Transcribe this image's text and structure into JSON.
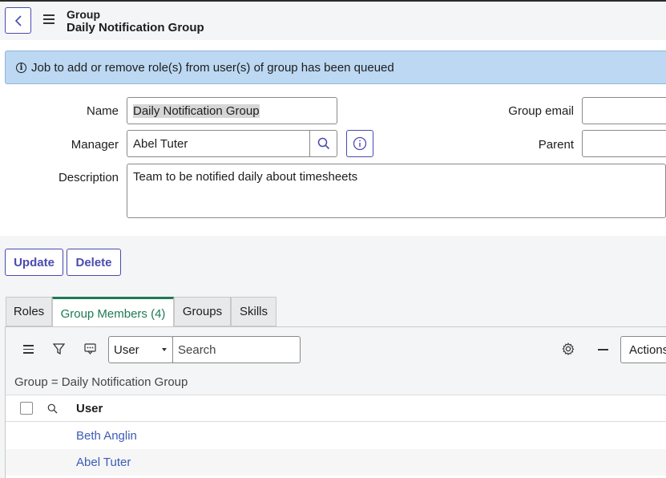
{
  "header": {
    "title": "Group",
    "subtitle": "Daily Notification Group"
  },
  "alert": {
    "message": "Job to add or remove role(s) from user(s) of group has been queued"
  },
  "form": {
    "name_label": "Name",
    "name_value": "Daily Notification Group",
    "manager_label": "Manager",
    "manager_value": "Abel Tuter",
    "description_label": "Description",
    "description_value": "Team to be notified daily about timesheets",
    "group_email_label": "Group email",
    "group_email_value": "",
    "parent_label": "Parent",
    "parent_value": ""
  },
  "buttons": {
    "update": "Update",
    "delete": "Delete"
  },
  "tabs": [
    {
      "label": "Roles"
    },
    {
      "label": "Group Members (4)",
      "active": true
    },
    {
      "label": "Groups"
    },
    {
      "label": "Skills"
    }
  ],
  "list": {
    "search_field_select": "User",
    "search_placeholder": "Search",
    "actions_label": "Actions",
    "filter_breadcrumb": "Group = Daily Notification Group",
    "column_user": "User",
    "rows": [
      {
        "user": "Beth Anglin"
      },
      {
        "user": "Abel Tuter"
      }
    ]
  },
  "colors": {
    "accent": "#4a4ab0",
    "alert_bg": "#bcd8f2",
    "active_tab": "#1d7a54",
    "link": "#3b5bb5"
  }
}
